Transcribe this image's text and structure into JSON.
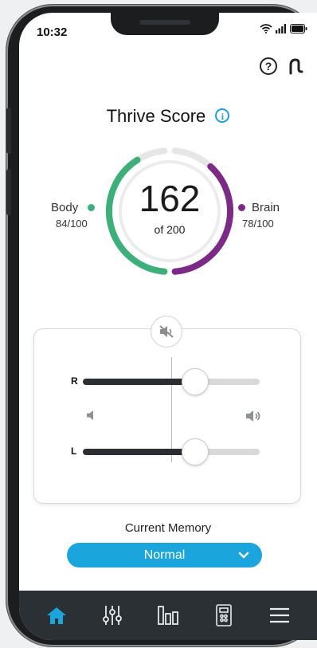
{
  "status_bar": {
    "time": "10:32"
  },
  "header": {
    "title": "Thrive Score"
  },
  "score": {
    "total": "162",
    "of_label": "of 200",
    "total_fraction": 0.81,
    "body": {
      "label": "Body",
      "value": "84/100",
      "fraction": 0.84,
      "color": "#3db07a"
    },
    "brain": {
      "label": "Brain",
      "value": "78/100",
      "fraction": 0.78,
      "color": "#7b2a86"
    }
  },
  "volume": {
    "right": {
      "label": "R",
      "level": 0.63
    },
    "left": {
      "label": "L",
      "level": 0.63
    }
  },
  "memory": {
    "title": "Current Memory",
    "selected": "Normal"
  },
  "tabs": [
    "home-icon",
    "equalizer-icon",
    "bar-chart-icon",
    "remote-icon",
    "menu-icon"
  ],
  "colors": {
    "accent": "#1aa6dc",
    "tabbar": "#2b3034"
  }
}
